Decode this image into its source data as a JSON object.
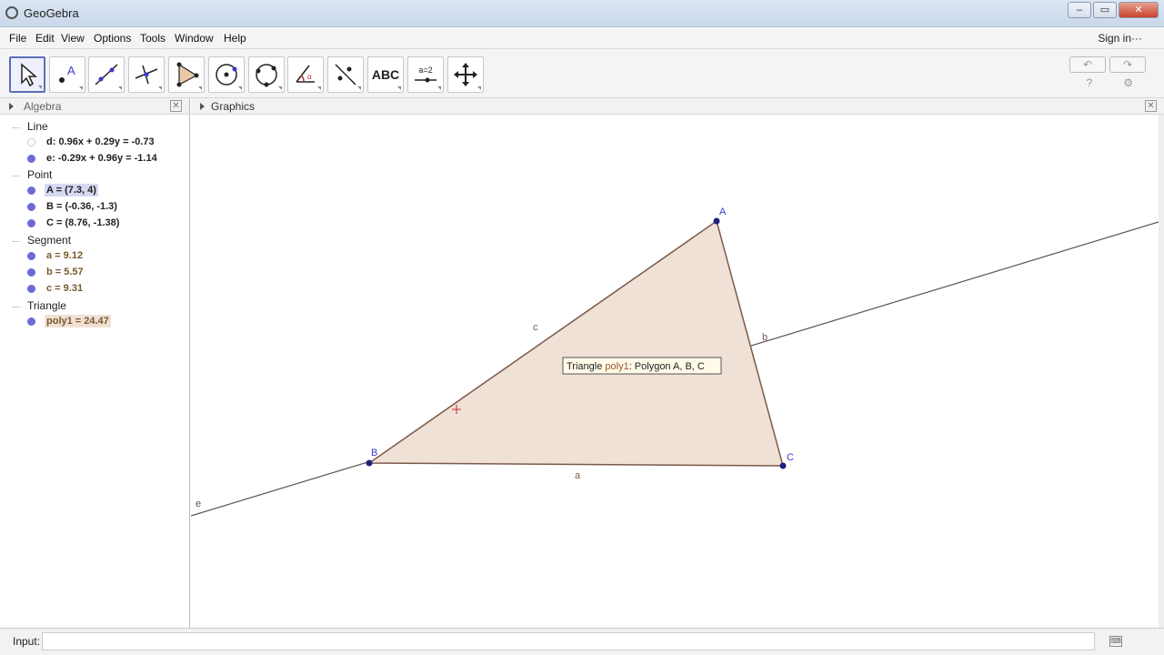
{
  "window": {
    "title": "GeoGebra",
    "minimize": "–",
    "maximize": "▭",
    "close": "✕"
  },
  "menu": {
    "items": [
      "File",
      "Edit",
      "View",
      "Options",
      "Tools",
      "Window",
      "Help"
    ],
    "sign_in": "Sign in···"
  },
  "toolbar": {
    "tools": [
      "move",
      "point",
      "line",
      "perpendicular-line",
      "polygon",
      "circle",
      "circle-through-points",
      "angle",
      "reflect",
      "text",
      "slider",
      "move-graphics"
    ],
    "active": "move",
    "text_tool_label": "ABC",
    "slider_label": "a=2",
    "undo": "↶",
    "redo": "↷",
    "help": "?",
    "settings": "⚙"
  },
  "algebra": {
    "title": "Algebra",
    "close": "✕",
    "groups": [
      {
        "label": "Line",
        "items": [
          {
            "text": "d: 0.96x + 0.29y = -0.73",
            "visible": false,
            "highlight": ""
          },
          {
            "text": "e: -0.29x + 0.96y = -1.14",
            "visible": true,
            "highlight": ""
          }
        ]
      },
      {
        "label": "Point",
        "items": [
          {
            "text": "A = (7.3, 4)",
            "visible": true,
            "highlight": "blue"
          },
          {
            "text": "B = (-0.36, -1.3)",
            "visible": true,
            "highlight": ""
          },
          {
            "text": "C = (8.76, -1.38)",
            "visible": true,
            "highlight": ""
          }
        ]
      },
      {
        "label": "Segment",
        "items": [
          {
            "text": "a = 9.12",
            "visible": true,
            "highlight": ""
          },
          {
            "text": "b = 5.57",
            "visible": true,
            "highlight": ""
          },
          {
            "text": "c = 9.31",
            "visible": true,
            "highlight": ""
          }
        ]
      },
      {
        "label": "Triangle",
        "items": [
          {
            "text": "poly1 = 24.47",
            "visible": true,
            "highlight": "orange"
          }
        ]
      }
    ]
  },
  "graphics": {
    "title": "Graphics",
    "close": "✕",
    "point_labels": {
      "A": "A",
      "B": "B",
      "C": "C"
    },
    "segment_labels": {
      "a": "a",
      "b": "b",
      "c": "c"
    },
    "line_label_e": "e",
    "tooltip_prefix": "Triangle ",
    "tooltip_name": "poly1",
    "tooltip_suffix": ": Polygon A, B, C",
    "colors": {
      "triangle_fill": "#efe1d6",
      "triangle_stroke": "#7a5a4a",
      "point": "#1a237e",
      "point_label": "#3a3acb",
      "line": "#555555"
    }
  },
  "input": {
    "label": "Input:",
    "value": "",
    "keyboard_icon": "⌨"
  }
}
